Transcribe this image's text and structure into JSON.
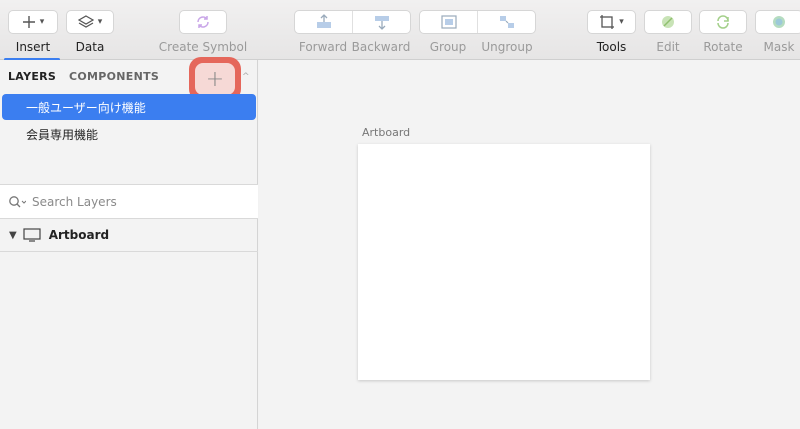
{
  "toolbar": {
    "insert_label": "Insert",
    "data_label": "Data",
    "create_symbol_label": "Create Symbol",
    "forward_label": "Forward",
    "backward_label": "Backward",
    "group_label": "Group",
    "ungroup_label": "Ungroup",
    "tools_label": "Tools",
    "edit_label": "Edit",
    "rotate_label": "Rotate",
    "mask_label": "Mask"
  },
  "panel": {
    "tabs": [
      "LAYERS",
      "COMPONENTS"
    ],
    "add_button_glyph": "+",
    "pages": [
      "一般ユーザー向け機能",
      "会員専用機能"
    ],
    "search_placeholder": "Search Layers",
    "layers": [
      {
        "name": "Artboard",
        "icon": "monitor-icon"
      }
    ]
  },
  "canvas": {
    "artboard_title": "Artboard"
  },
  "colors": {
    "accent": "#3b7ef0",
    "highlight": "#e5675b"
  }
}
